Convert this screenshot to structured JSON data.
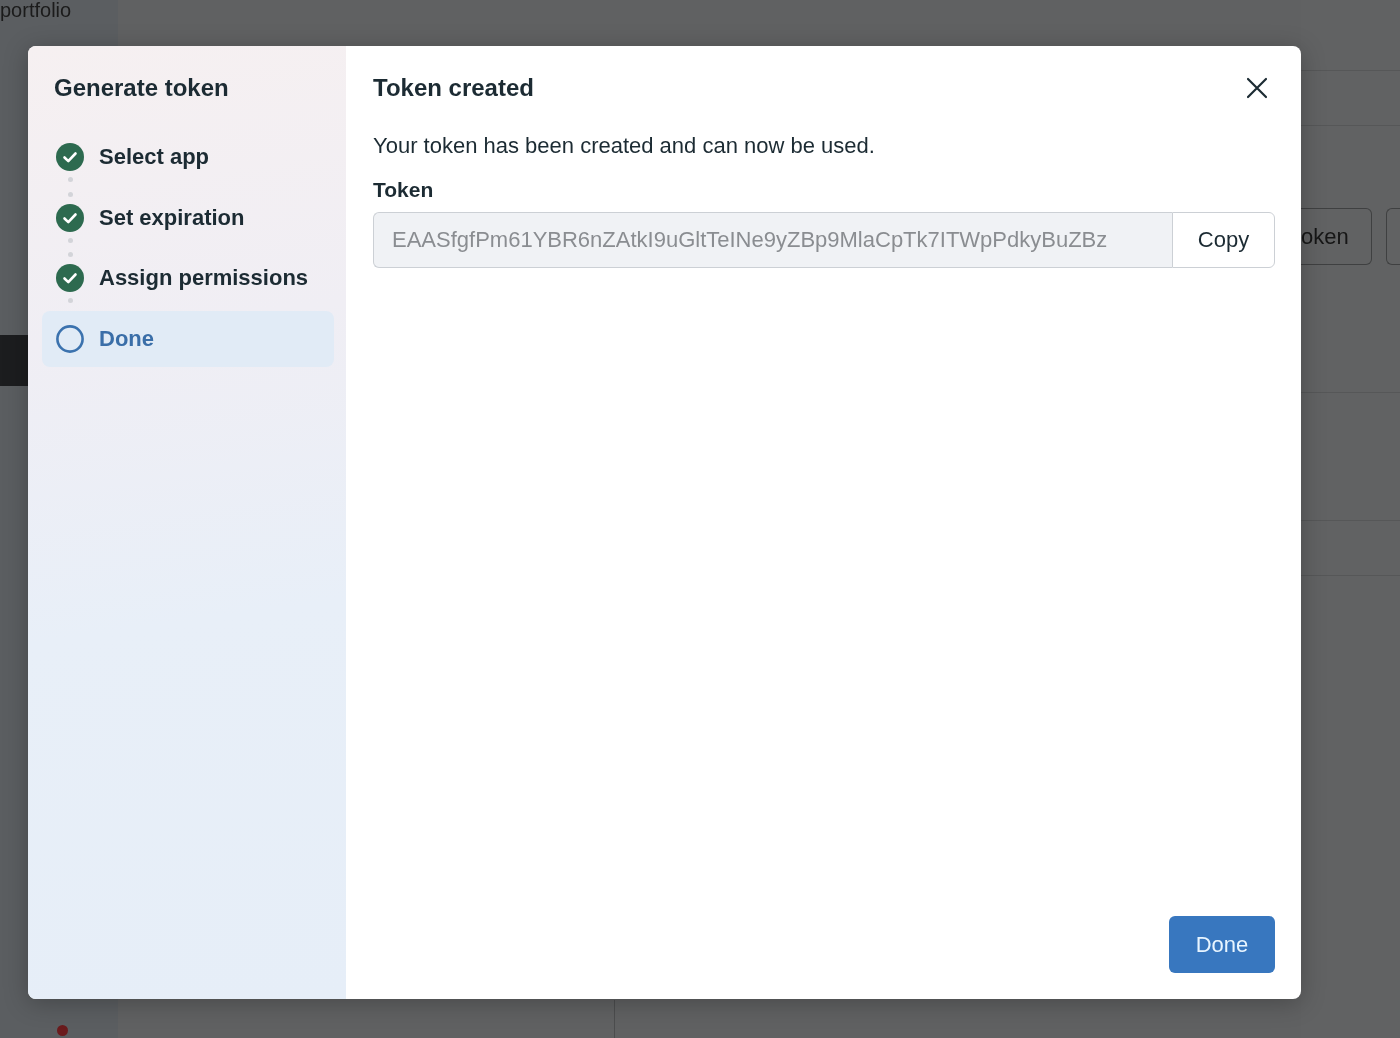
{
  "background": {
    "page_title": "portfolio",
    "button_label": "oken"
  },
  "dialog": {
    "sidebar": {
      "title": "Generate token",
      "steps": [
        {
          "label": "Select app",
          "done": true,
          "selected": false
        },
        {
          "label": "Set expiration",
          "done": true,
          "selected": false
        },
        {
          "label": "Assign permissions",
          "done": true,
          "selected": false
        },
        {
          "label": "Done",
          "done": false,
          "selected": true
        }
      ]
    },
    "content": {
      "title": "Token created",
      "message": "Your token has been created and can now be used.",
      "token_field": {
        "label": "Token",
        "value": "EAASfgfPm61YBR6nZAtkI9uGltTeINe9yZBp9MlaCpTk7ITWpPdkyBuZBz"
      },
      "copy_button": "Copy",
      "done_button": "Done"
    }
  }
}
